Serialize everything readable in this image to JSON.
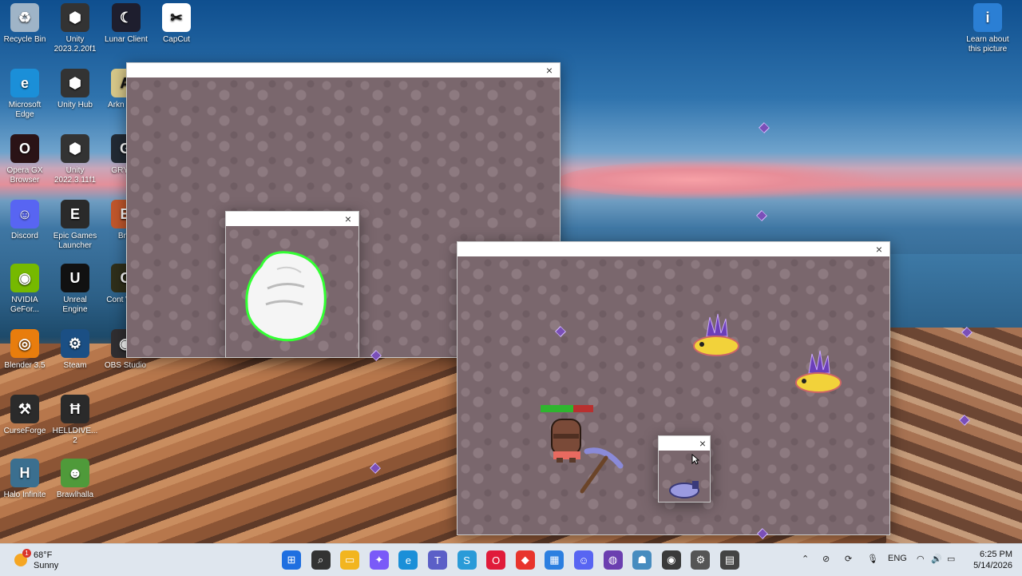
{
  "desktop": {
    "icons": [
      {
        "id": "recycle-bin",
        "label": "Recycle Bin",
        "color": "#9fb4c7",
        "glyph": "♻"
      },
      {
        "id": "unity-2023",
        "label": "Unity 2023.2.20f1",
        "color": "#333333",
        "glyph": "⬢"
      },
      {
        "id": "lunar-client",
        "label": "Lunar Client",
        "color": "#1e1e2e",
        "glyph": "☾"
      },
      {
        "id": "capcut",
        "label": "CapCut",
        "color": "#ffffff",
        "glyph": "✂"
      },
      {
        "id": "microsoft-edge",
        "label": "Microsoft Edge",
        "color": "#1b8fd8",
        "glyph": "e"
      },
      {
        "id": "unity-hub",
        "label": "Unity Hub",
        "color": "#333333",
        "glyph": "⬢"
      },
      {
        "id": "arknights",
        "label": "Arkn Endf",
        "color": "#d8c98a",
        "glyph": "A"
      },
      {
        "id": "opera-gx",
        "label": "Opera GX Browser",
        "color": "#2a1316",
        "glyph": "O"
      },
      {
        "id": "unity-2022",
        "label": "Unity 2022.3.11f1",
        "color": "#333333",
        "glyph": "⬢"
      },
      {
        "id": "gryphlink",
        "label": "GRYPH",
        "color": "#222a34",
        "glyph": "G"
      },
      {
        "id": "discord",
        "label": "Discord",
        "color": "#5865f2",
        "glyph": "☺"
      },
      {
        "id": "epic-games",
        "label": "Epic Games Launcher",
        "color": "#2a2a2a",
        "glyph": "E"
      },
      {
        "id": "brotato",
        "label": "Brot",
        "color": "#c2572c",
        "glyph": "B"
      },
      {
        "id": "nvidia",
        "label": "NVIDIA GeFor...",
        "color": "#76b900",
        "glyph": "◉"
      },
      {
        "id": "unreal",
        "label": "Unreal Engine",
        "color": "#111111",
        "glyph": "U"
      },
      {
        "id": "content-warning",
        "label": "Cont Warn",
        "color": "#2f2f1a",
        "glyph": "C"
      },
      {
        "id": "blender",
        "label": "Blender 3.5",
        "color": "#e87d0d",
        "glyph": "◎"
      },
      {
        "id": "steam",
        "label": "Steam",
        "color": "#1b4f84",
        "glyph": "⚙"
      },
      {
        "id": "obs",
        "label": "OBS Studio",
        "color": "#302e31",
        "glyph": "◉"
      },
      {
        "id": "curseforge",
        "label": "CurseForge",
        "color": "#2b2b2b",
        "glyph": "⚒"
      },
      {
        "id": "helldivers",
        "label": "HELLDIVE... 2",
        "color": "#2a2a2a",
        "glyph": "Ħ"
      },
      {
        "id": "halo",
        "label": "Halo Infinite",
        "color": "#3b6f8f",
        "glyph": "H"
      },
      {
        "id": "brawlhalla",
        "label": "Brawlhalla",
        "color": "#4f9a3a",
        "glyph": "☻"
      },
      {
        "id": "learn-picture",
        "label": "Learn about this picture",
        "color": "#2b7fd4",
        "glyph": "i"
      }
    ]
  },
  "windows": {
    "top_left": {
      "close": "×"
    },
    "hand": {
      "close": "×"
    },
    "main": {
      "close": "×"
    },
    "small": {
      "close": "×"
    }
  },
  "game": {
    "player_health_fraction": 0.62,
    "health_colors": {
      "full": "#2fb52f",
      "empty": "#b8302f"
    }
  },
  "taskbar": {
    "weather": {
      "temp": "68°F",
      "condition": "Sunny",
      "badge": "1"
    },
    "apps": [
      {
        "name": "start-icon",
        "glyph": "⊞",
        "color": "#1f6fe0"
      },
      {
        "name": "search-icon",
        "glyph": "⌕",
        "color": "#333333"
      },
      {
        "name": "file-explorer-icon",
        "glyph": "▭",
        "color": "#f2b51f"
      },
      {
        "name": "copilot-icon",
        "glyph": "✦",
        "color": "#7a5af8"
      },
      {
        "name": "edge-icon",
        "glyph": "e",
        "color": "#1b8fd8"
      },
      {
        "name": "teams-icon",
        "glyph": "T",
        "color": "#5b5fc7"
      },
      {
        "name": "chrome-update-icon",
        "glyph": "S",
        "color": "#2a9bd8"
      },
      {
        "name": "opera-gx-icon",
        "glyph": "O",
        "color": "#e01b3a"
      },
      {
        "name": "git-icon",
        "glyph": "◆",
        "color": "#e8342c"
      },
      {
        "name": "store-icon",
        "glyph": "▦",
        "color": "#2c7fe0"
      },
      {
        "name": "discord-icon",
        "glyph": "☺",
        "color": "#5865f2"
      },
      {
        "name": "github-icon",
        "glyph": "◍",
        "color": "#6b3fb0"
      },
      {
        "name": "godot-icon",
        "glyph": "☗",
        "color": "#478cbf"
      },
      {
        "name": "obs-icon",
        "glyph": "◉",
        "color": "#3a3a3a"
      },
      {
        "name": "settings-icon",
        "glyph": "⚙",
        "color": "#555555"
      },
      {
        "name": "game-window-icon",
        "glyph": "▤",
        "color": "#444444"
      }
    ],
    "tray": {
      "language": "ENG",
      "time": "6:25 PM",
      "date": "5/14/2026"
    }
  }
}
